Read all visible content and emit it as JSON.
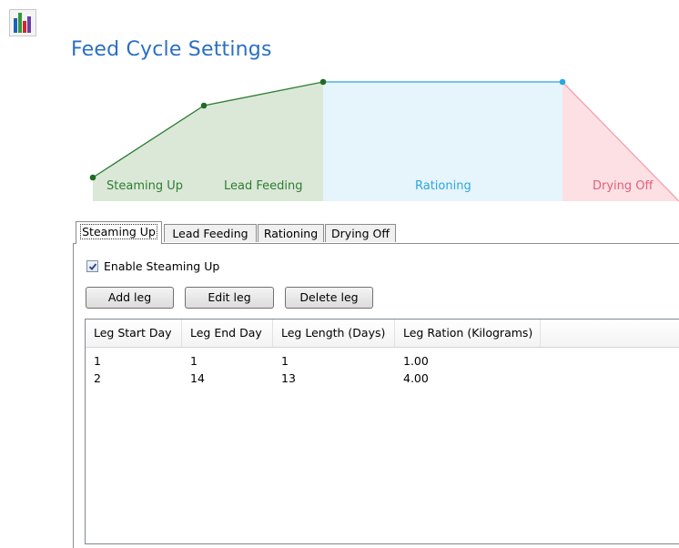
{
  "header": {
    "title": "Feed Cycle Settings",
    "app_icon": "bar-chart-icon"
  },
  "diagram": {
    "phases": [
      {
        "label": "Steaming Up",
        "color": "#2e7d32",
        "fill": "#dbe8d8"
      },
      {
        "label": "Lead Feeding",
        "color": "#2e7d32",
        "fill": "#dbe8d8"
      },
      {
        "label": "Rationing",
        "color": "#2aa8e0",
        "fill": "#e6f4fc"
      },
      {
        "label": "Drying Off",
        "color": "#e0607a",
        "fill": "#fde0e3"
      }
    ]
  },
  "tabs": [
    {
      "label": "Steaming Up",
      "active": true
    },
    {
      "label": "Lead Feeding",
      "active": false
    },
    {
      "label": "Rationing",
      "active": false
    },
    {
      "label": "Drying Off",
      "active": false
    }
  ],
  "panel": {
    "enable_label": "Enable Steaming Up",
    "enable_checked": true,
    "buttons": {
      "add": "Add leg",
      "edit": "Edit leg",
      "delete": "Delete leg"
    },
    "table": {
      "columns": [
        "Leg Start Day",
        "Leg End Day",
        "Leg Length (Days)",
        "Leg Ration (Kilograms)"
      ],
      "rows": [
        [
          "1",
          "1",
          "1",
          "1.00"
        ],
        [
          "2",
          "14",
          "13",
          "4.00"
        ]
      ]
    }
  }
}
